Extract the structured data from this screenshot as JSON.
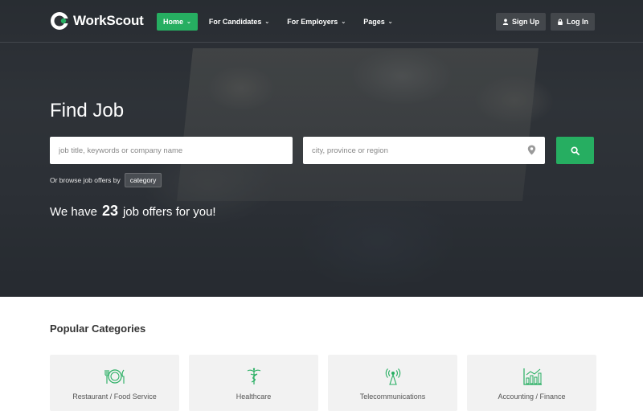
{
  "brand": {
    "name": "WorkScout",
    "accent": "#26ae61"
  },
  "nav": [
    {
      "label": "Home",
      "active": true
    },
    {
      "label": "For Candidates",
      "active": false
    },
    {
      "label": "For Employers",
      "active": false
    },
    {
      "label": "Pages",
      "active": false
    }
  ],
  "auth": {
    "signup_label": "Sign Up",
    "login_label": "Log In"
  },
  "hero": {
    "title": "Find Job",
    "search_placeholder": "job title, keywords or company name",
    "location_placeholder": "city, province or region",
    "browse_text": "Or browse job offers by",
    "browse_tag": "category",
    "counter_prefix": "We have",
    "counter_value": "23",
    "counter_suffix": "job offers for you!"
  },
  "categories": {
    "title": "Popular Categories",
    "items": [
      {
        "label": "Restaurant / Food Service",
        "icon": "restaurant-icon"
      },
      {
        "label": "Healthcare",
        "icon": "caduceus-icon"
      },
      {
        "label": "Telecommunications",
        "icon": "antenna-icon"
      },
      {
        "label": "Accounting / Finance",
        "icon": "chart-icon"
      }
    ]
  }
}
